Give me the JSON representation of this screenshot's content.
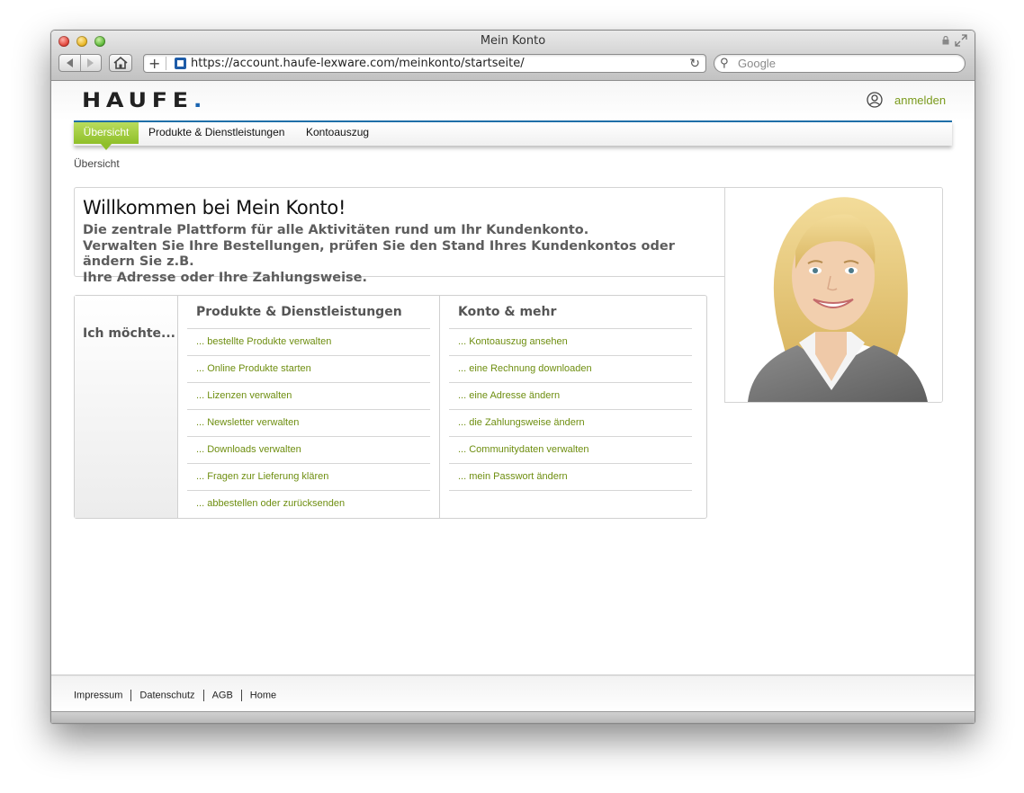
{
  "window": {
    "title": "Mein Konto"
  },
  "browser": {
    "url": "https://account.haufe-lexware.com/meinkonto/startseite/",
    "search_placeholder": "Google"
  },
  "header": {
    "logo": "HAUFE",
    "login_label": "anmelden"
  },
  "nav": {
    "tabs": [
      {
        "label": "Übersicht",
        "active": true
      },
      {
        "label": "Produkte & Dienstleistungen"
      },
      {
        "label": "Kontoauszug"
      }
    ]
  },
  "breadcrumb": "Übersicht",
  "welcome": {
    "title": "Willkommen bei Mein Konto!",
    "line1": "Die zentrale Plattform für alle Aktivitäten rund um Ihr Kundenkonto.",
    "line2": "Verwalten Sie Ihre Bestellungen, prüfen Sie den Stand Ihres Kundenkontos oder ändern Sie z.B.",
    "line3": "Ihre Adresse oder Ihre Zahlungsweise."
  },
  "actions": {
    "label": "Ich möchte...",
    "columns": [
      {
        "heading": "Produkte & Dienstleistungen",
        "links": [
          "... bestellte Produkte verwalten",
          "... Online Produkte starten",
          "... Lizenzen verwalten",
          "... Newsletter verwalten",
          "... Downloads verwalten",
          "... Fragen zur Lieferung klären",
          "... abbestellen oder zurücksenden"
        ]
      },
      {
        "heading": "Konto & mehr",
        "links": [
          "... Kontoauszug ansehen",
          "... eine Rechnung downloaden",
          "... eine Adresse ändern",
          "... die Zahlungsweise ändern",
          "... Communitydaten verwalten",
          "... mein Passwort ändern"
        ]
      }
    ]
  },
  "footer": {
    "links": [
      "Impressum",
      "Datenschutz",
      "AGB",
      "Home"
    ]
  },
  "colors": {
    "accent_green": "#8fbf2a",
    "link_green": "#6e8e10",
    "nav_blue": "#1f6fa8"
  }
}
